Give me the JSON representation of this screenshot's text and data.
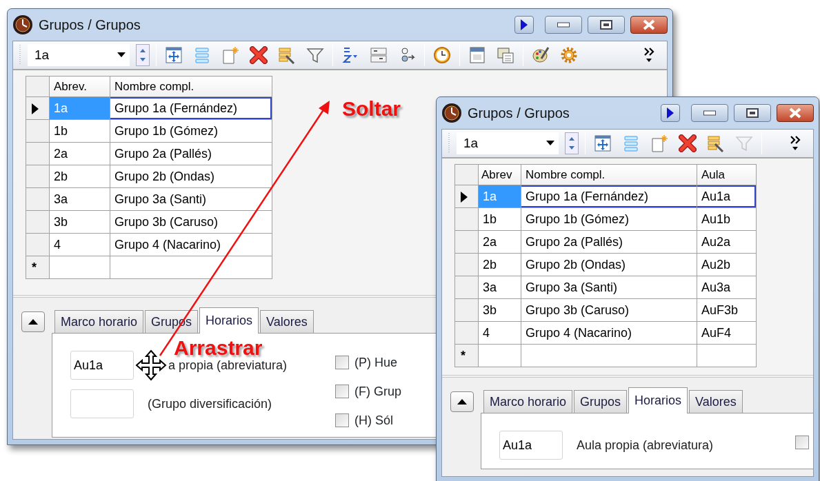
{
  "windows": [
    {
      "title": "Grupos / Grupos",
      "toolbar": {
        "combo": "1a",
        "items": [
          {
            "kind": "separator"
          },
          {
            "kind": "move",
            "disabled": false
          },
          {
            "kind": "rows",
            "disabled": false
          },
          {
            "kind": "newdoc",
            "disabled": false
          },
          {
            "kind": "delete",
            "disabled": false
          },
          {
            "kind": "editlist",
            "disabled": false
          },
          {
            "kind": "filter",
            "disabled": false
          },
          {
            "kind": "separator"
          },
          {
            "kind": "sort",
            "disabled": false
          },
          {
            "kind": "grid",
            "disabled": false
          },
          {
            "kind": "people",
            "disabled": false
          },
          {
            "kind": "separator"
          },
          {
            "kind": "clock",
            "disabled": false
          },
          {
            "kind": "separator"
          },
          {
            "kind": "calendar",
            "disabled": false
          },
          {
            "kind": "windows",
            "disabled": false
          },
          {
            "kind": "separator"
          },
          {
            "kind": "palette",
            "disabled": false
          },
          {
            "kind": "gear",
            "disabled": false
          },
          {
            "kind": "overflow",
            "disabled": false
          }
        ]
      },
      "table": {
        "columns": [
          "Abrev.",
          "Nombre compl."
        ],
        "rows": [
          {
            "cells": [
              "1a",
              "Grupo 1a (Fernández)"
            ],
            "selected": true
          },
          {
            "cells": [
              "1b",
              "Grupo 1b (Gómez)"
            ],
            "selected": false
          },
          {
            "cells": [
              "2a",
              "Grupo 2a (Pallés)"
            ],
            "selected": false
          },
          {
            "cells": [
              "2b",
              "Grupo 2b (Ondas)"
            ],
            "selected": false
          },
          {
            "cells": [
              "3a",
              "Grupo 3a (Santi)"
            ],
            "selected": false
          },
          {
            "cells": [
              "3b",
              "Grupo 3b (Caruso)"
            ],
            "selected": false
          },
          {
            "cells": [
              "4",
              "Grupo 4 (Nacarino)"
            ],
            "selected": false
          }
        ],
        "new_row_marker": "*"
      },
      "tabs": [
        {
          "label": "Marco horario",
          "selected": false
        },
        {
          "label": "Grupos",
          "selected": false
        },
        {
          "label": "Horarios",
          "selected": true
        },
        {
          "label": "Valores",
          "selected": false
        }
      ],
      "fields": [
        {
          "value": "Au1a",
          "label": "a propia (abreviatura)"
        },
        {
          "label": "(Grupo diversificación)"
        }
      ],
      "checks": [
        {
          "label": "(P) Hue",
          "checked": false
        },
        {
          "label": "(F) Grup",
          "checked": false
        },
        {
          "label": "(H) Sól",
          "checked": false
        }
      ]
    },
    {
      "title": "Grupos / Grupos",
      "toolbar": {
        "combo": "1a",
        "items": [
          {
            "kind": "separator"
          },
          {
            "kind": "move",
            "disabled": false
          },
          {
            "kind": "rows",
            "disabled": false
          },
          {
            "kind": "newdoc",
            "disabled": false
          },
          {
            "kind": "delete",
            "disabled": false
          },
          {
            "kind": "editlist",
            "disabled": false
          },
          {
            "kind": "filter",
            "disabled": true
          },
          {
            "kind": "separator"
          },
          {
            "kind": "overflow",
            "disabled": false
          }
        ]
      },
      "table": {
        "columns": [
          "Abrev",
          "Nombre compl.",
          "Aula"
        ],
        "rows": [
          {
            "cells": [
              "1a",
              "Grupo 1a (Fernández)",
              "Au1a"
            ],
            "selected": true
          },
          {
            "cells": [
              "1b",
              "Grupo 1b (Gómez)",
              "Au1b"
            ],
            "selected": false
          },
          {
            "cells": [
              "2a",
              "Grupo 2a (Pallés)",
              "Au2a"
            ],
            "selected": false
          },
          {
            "cells": [
              "2b",
              "Grupo 2b (Ondas)",
              "Au2b"
            ],
            "selected": false
          },
          {
            "cells": [
              "3a",
              "Grupo 3a (Santi)",
              "Au3a"
            ],
            "selected": false
          },
          {
            "cells": [
              "3b",
              "Grupo 3b (Caruso)",
              "AuF3b"
            ],
            "selected": false
          },
          {
            "cells": [
              "4",
              "Grupo 4 (Nacarino)",
              "AuF4"
            ],
            "selected": false
          }
        ],
        "new_row_marker": "*"
      },
      "tabs": [
        {
          "label": "Marco horario",
          "selected": false
        },
        {
          "label": "Grupos",
          "selected": false
        },
        {
          "label": "Horarios",
          "selected": true
        },
        {
          "label": "Valores",
          "selected": false
        }
      ],
      "fields": [
        {
          "value": "Au1a",
          "label": "Aula propia (abreviatura)"
        }
      ],
      "checks": [
        {
          "checked": false
        }
      ]
    }
  ],
  "annotations": [
    {
      "kind": "drop",
      "text": "Soltar"
    },
    {
      "kind": "drag",
      "text": "Arrastrar"
    }
  ]
}
